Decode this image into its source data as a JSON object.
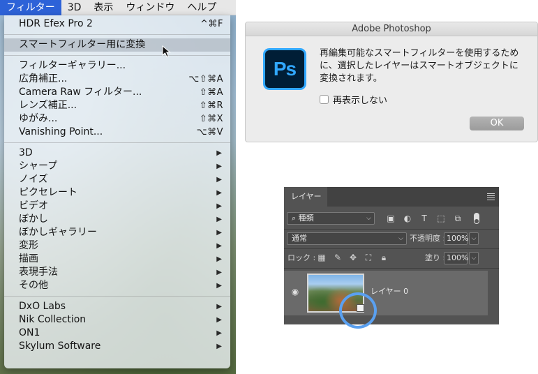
{
  "menubar": {
    "items": [
      "フィルター",
      "3D",
      "表示",
      "ウィンドウ",
      "ヘルプ"
    ]
  },
  "filter_menu": {
    "recent": {
      "label": "HDR Efex Pro 2",
      "shortcut": "^⌘F"
    },
    "convert_smart": "スマートフィルター用に変換",
    "group_main": [
      {
        "label": "フィルターギャラリー...",
        "shortcut": ""
      },
      {
        "label": "広角補正...",
        "shortcut": "⌥⇧⌘A"
      },
      {
        "label": "Camera Raw フィルター...",
        "shortcut": "⇧⌘A"
      },
      {
        "label": "レンズ補正...",
        "shortcut": "⇧⌘R"
      },
      {
        "label": "ゆがみ...",
        "shortcut": "⇧⌘X"
      },
      {
        "label": "Vanishing Point...",
        "shortcut": "⌥⌘V"
      }
    ],
    "group_sub": [
      "3D",
      "シャープ",
      "ノイズ",
      "ピクセレート",
      "ビデオ",
      "ぼかし",
      "ぼかしギャラリー",
      "変形",
      "描画",
      "表現手法",
      "その他"
    ],
    "group_plugins": [
      "DxO Labs",
      "Nik Collection",
      "ON1",
      "Skylum Software"
    ],
    "submenu_arrow": "▶"
  },
  "dialog": {
    "title": "Adobe Photoshop",
    "logo_text": "Ps",
    "message": "再編集可能なスマートフィルターを使用するために、選択したレイヤーはスマートオブジェクトに変換されます。",
    "checkbox_label": "再表示しない",
    "ok_label": "OK"
  },
  "layers_panel": {
    "tab_label": "レイヤー",
    "kind_label": "種類",
    "blend_mode": "通常",
    "opacity_label": "不透明度 :",
    "opacity_value": "100%",
    "lock_label": "ロック :",
    "fill_label": "塗り :",
    "fill_value": "100%",
    "layer_name": "レイヤー 0"
  },
  "colors": {
    "menubar_active": "#2d62d8",
    "ps_logo_bg": "#001e36",
    "ps_logo_fg": "#31a8ff",
    "highlight_circle": "#5aa0f0"
  }
}
